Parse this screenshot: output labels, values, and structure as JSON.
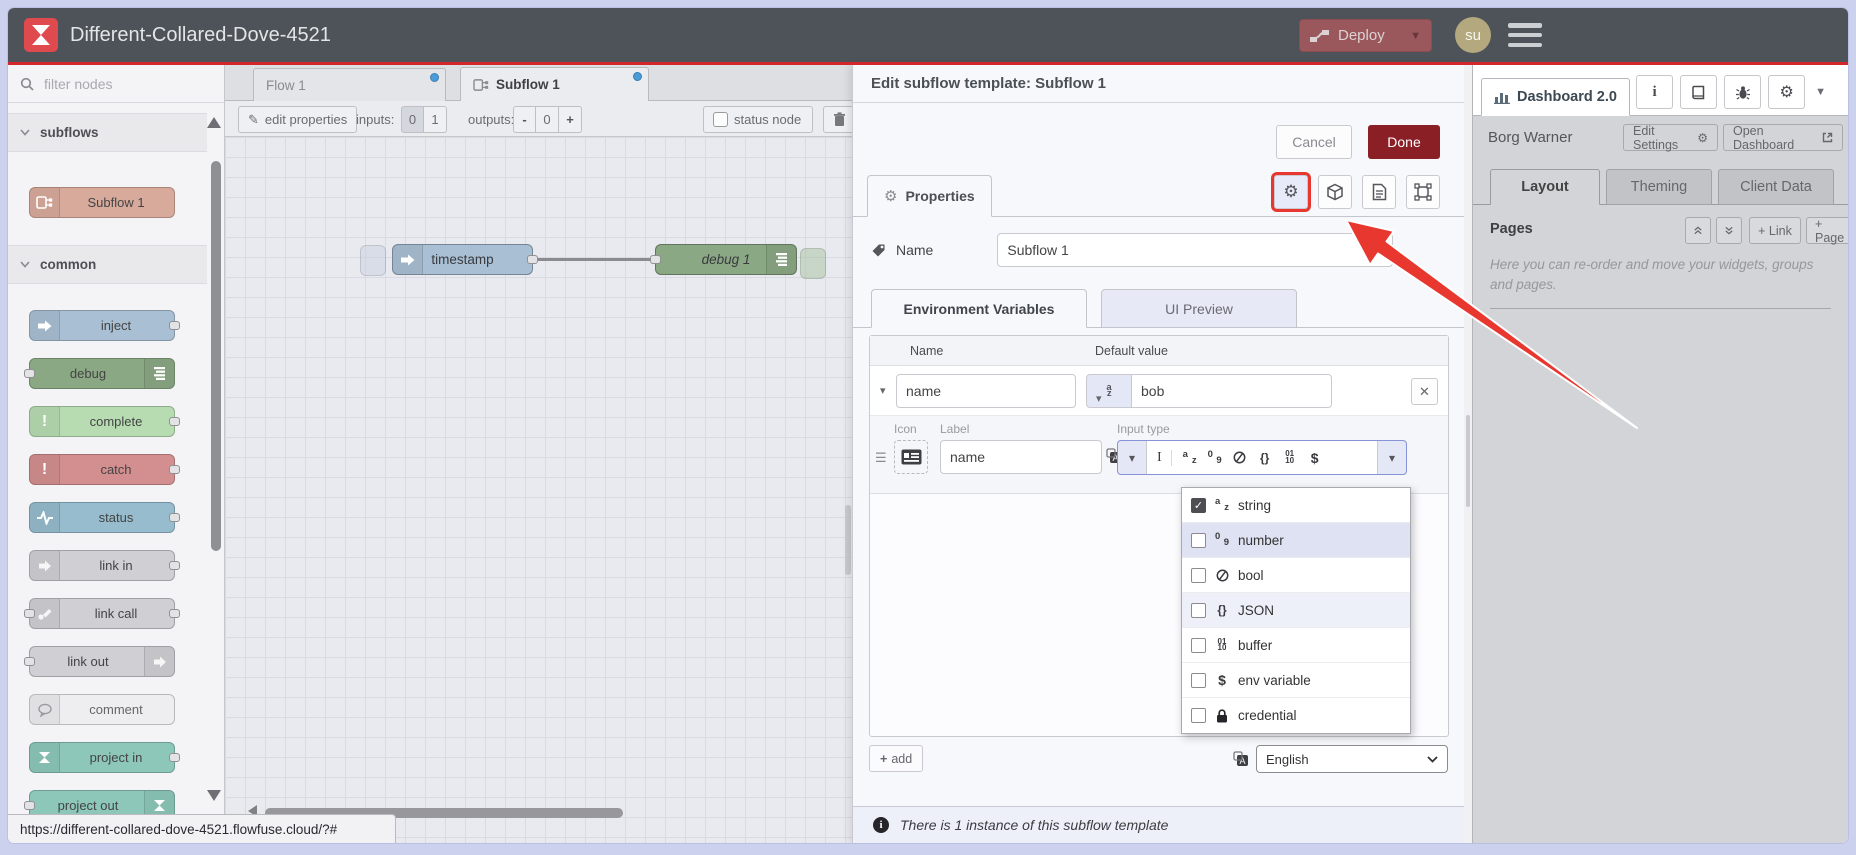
{
  "header": {
    "title": "Different-Collared-Dove-4521",
    "deploy": "Deploy",
    "avatar": "su"
  },
  "palette": {
    "filter_placeholder": "filter nodes",
    "subflows_label": "subflows",
    "common_label": "common",
    "subflow_node": "Subflow 1",
    "common_nodes": [
      "inject",
      "debug",
      "complete",
      "catch",
      "status",
      "link in",
      "link call",
      "link out",
      "comment",
      "project in",
      "project out"
    ]
  },
  "workspace": {
    "tabs": [
      "Flow 1",
      "Subflow 1"
    ],
    "toolbar": {
      "edit_properties": "edit properties",
      "inputs_label": "inputs:",
      "inputs_options": [
        "0",
        "1"
      ],
      "outputs_label": "outputs:",
      "minus": "-",
      "outputs_value": "0",
      "plus": "+",
      "status_node": "status node"
    },
    "nodes": {
      "inject": "timestamp",
      "debug": "debug 1"
    }
  },
  "dialog": {
    "title": "Edit subflow template: Subflow 1",
    "cancel": "Cancel",
    "done": "Done",
    "properties_tab": "Properties",
    "name_label": "Name",
    "name_value": "Subflow 1",
    "tab_env": "Environment Variables",
    "tab_ui": "UI Preview",
    "col_name": "Name",
    "col_default": "Default value",
    "env_name": "name",
    "env_value": "bob",
    "icon_label": "Icon",
    "label_label": "Label",
    "label_value": "name",
    "input_type_label": "Input type",
    "type_menu": [
      {
        "label": "string",
        "checked": true
      },
      {
        "label": "number",
        "checked": false
      },
      {
        "label": "bool",
        "checked": false
      },
      {
        "label": "JSON",
        "checked": false
      },
      {
        "label": "buffer",
        "checked": false
      },
      {
        "label": "env variable",
        "checked": false
      },
      {
        "label": "credential",
        "checked": false
      }
    ],
    "add_button": "add",
    "language": "English",
    "footer_note": "There is 1 instance of this subflow template"
  },
  "sidebar": {
    "tab": "Dashboard 2.0",
    "instance_name": "Borg Warner",
    "edit_settings": "Edit Settings",
    "open_dashboard": "Open Dashboard",
    "tabs": [
      "Layout",
      "Theming",
      "Client Data"
    ],
    "pages_label": "Pages",
    "add_link": "+ Link",
    "add_page": "+ Page",
    "help_text": "Here you can re-order and move your widgets, groups and pages."
  },
  "statusbar": {
    "url": "https://different-collared-dove-4521.flowfuse.cloud/?#"
  },
  "colors": {
    "header_bg": "#4d5358",
    "header_underline": "#d3262c",
    "deploy_bg": "#9b585c",
    "done_bg": "#8a1f26",
    "annotation_red": "#e8372f",
    "tab_dot": "#4a9bd8",
    "node_subflow": "#d8aa9c",
    "node_inject": "#a9bfd3",
    "node_debug": "#8ba884",
    "node_complete": "#b7dcb2",
    "node_catch": "#d38f8f",
    "node_status": "#97bccd",
    "node_link": "#cfcfd4",
    "node_comment": "#eeeef0",
    "node_project": "#8cc7ba"
  }
}
